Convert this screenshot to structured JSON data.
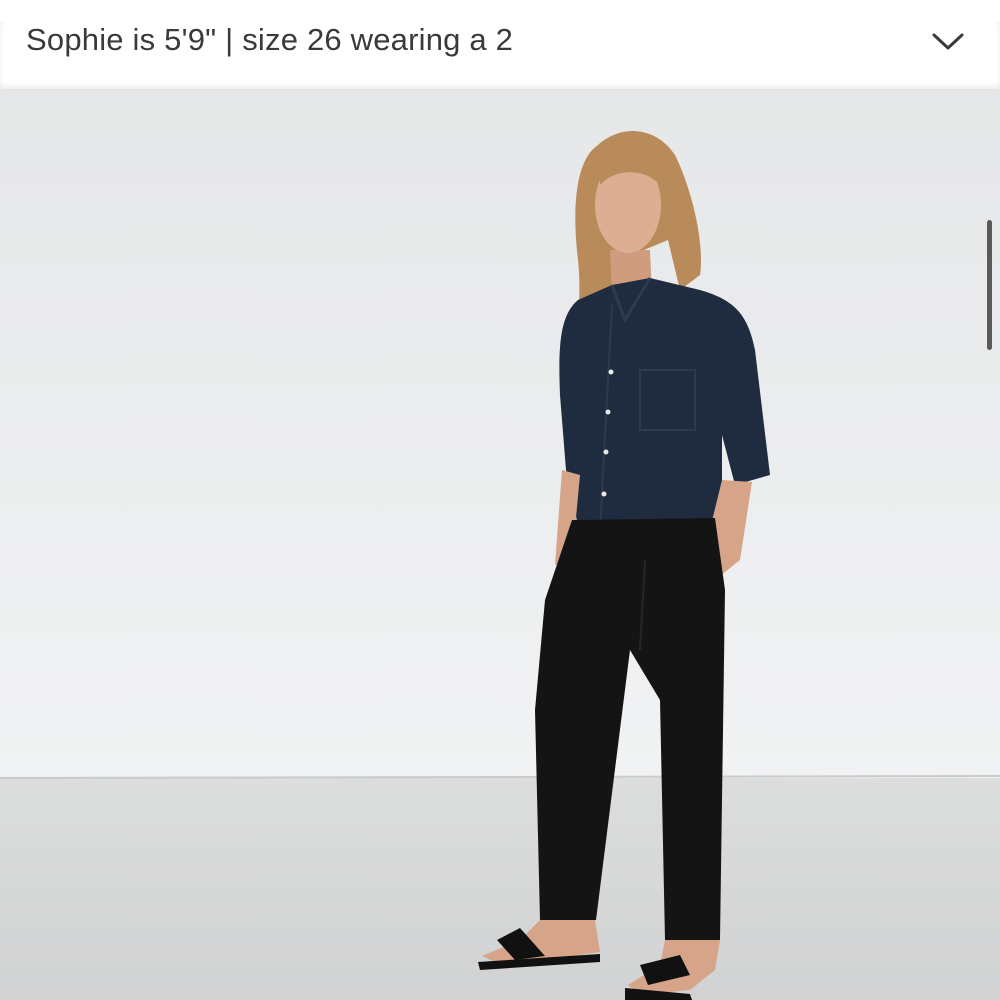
{
  "model_info": {
    "text": "Sophie is 5'9\" | size 26 wearing a 2",
    "expand_icon": "chevron-down-icon"
  },
  "product_image": {
    "subject": "model-photo",
    "colors": {
      "backdrop_wall": "#e9eaeb",
      "floor": "#d6d7d8",
      "shirt": "#1f2c3f",
      "pants": "#141414",
      "skin": "#d9a98c",
      "hair": "#b98a5a",
      "sandals": "#111111"
    }
  },
  "colors": {
    "text": "#3a3a3a",
    "bar_background": "#ffffff",
    "scrollbar": "#5a5a5a"
  }
}
